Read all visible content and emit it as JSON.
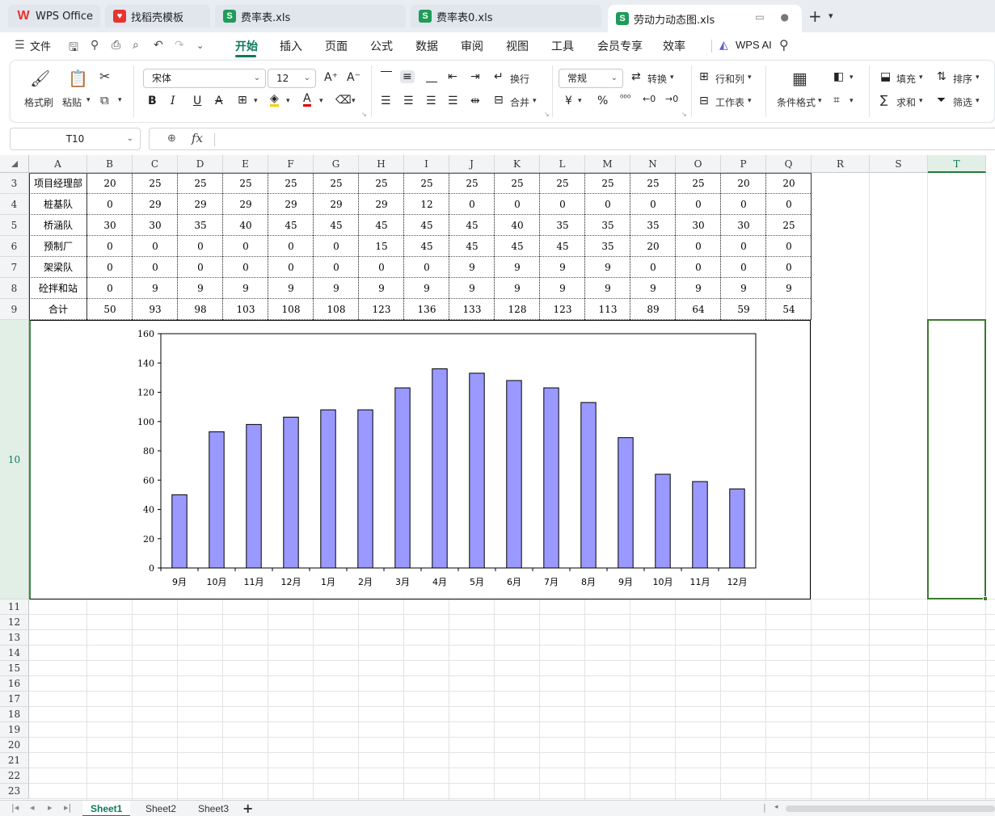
{
  "tabs": [
    {
      "label": "WPS Office",
      "icon": "wps-logo-icon"
    },
    {
      "label": "找稻壳模板",
      "icon": "daoke-icon"
    },
    {
      "label": "费率表.xls",
      "icon": "sheet-icon"
    },
    {
      "label": "费率表0.xls",
      "icon": "sheet-icon"
    },
    {
      "label": "劳动力动态图.xls",
      "icon": "sheet-icon"
    }
  ],
  "menu": {
    "file": "文件",
    "items": [
      "开始",
      "插入",
      "页面",
      "公式",
      "数据",
      "审阅",
      "视图",
      "工具",
      "会员专享",
      "效率"
    ],
    "active": "开始",
    "wps_ai": "WPS AI"
  },
  "ribbon": {
    "format_painter": "格式刷",
    "paste": "粘贴",
    "font_name": "宋体",
    "font_size": "12",
    "wrap": "换行",
    "merge": "合并",
    "number_format": "常规",
    "convert": "转换",
    "row_col": "行和列",
    "worksheet": "工作表",
    "cond_format": "条件格式",
    "fill": "填充",
    "sum": "求和",
    "sort": "排序",
    "filter": "筛选",
    "accent_color": "#0c7a5b"
  },
  "formula": {
    "cell_ref": "T10",
    "fx": "fx",
    "content": ""
  },
  "columns": [
    "A",
    "B",
    "C",
    "D",
    "E",
    "F",
    "G",
    "H",
    "I",
    "J",
    "K",
    "L",
    "M",
    "N",
    "O",
    "P",
    "Q",
    "R",
    "S",
    "T"
  ],
  "selected_column": "T",
  "selected_row": "10",
  "rows": [
    {
      "num": "3",
      "label": "项目经理部",
      "values": [
        "20",
        "25",
        "25",
        "25",
        "25",
        "25",
        "25",
        "25",
        "25",
        "25",
        "25",
        "25",
        "25",
        "25",
        "20",
        "20"
      ]
    },
    {
      "num": "4",
      "label": "桩基队",
      "values": [
        "0",
        "29",
        "29",
        "29",
        "29",
        "29",
        "29",
        "12",
        "0",
        "0",
        "0",
        "0",
        "0",
        "0",
        "0",
        "0"
      ]
    },
    {
      "num": "5",
      "label": "桥涵队",
      "values": [
        "30",
        "30",
        "35",
        "40",
        "45",
        "45",
        "45",
        "45",
        "45",
        "40",
        "35",
        "35",
        "35",
        "30",
        "30",
        "25"
      ]
    },
    {
      "num": "6",
      "label": "预制厂",
      "values": [
        "0",
        "0",
        "0",
        "0",
        "0",
        "0",
        "15",
        "45",
        "45",
        "45",
        "45",
        "35",
        "20",
        "0",
        "0",
        "0"
      ]
    },
    {
      "num": "7",
      "label": "架梁队",
      "values": [
        "0",
        "0",
        "0",
        "0",
        "0",
        "0",
        "0",
        "0",
        "9",
        "9",
        "9",
        "9",
        "0",
        "0",
        "0",
        "0"
      ]
    },
    {
      "num": "8",
      "label": "砼拌和站",
      "values": [
        "0",
        "9",
        "9",
        "9",
        "9",
        "9",
        "9",
        "9",
        "9",
        "9",
        "9",
        "9",
        "9",
        "9",
        "9",
        "9"
      ]
    },
    {
      "num": "9",
      "label": "合计",
      "values": [
        "50",
        "93",
        "98",
        "103",
        "108",
        "108",
        "123",
        "136",
        "133",
        "128",
        "123",
        "113",
        "89",
        "64",
        "59",
        "54"
      ]
    }
  ],
  "empty_rows": [
    "11",
    "12",
    "13",
    "14",
    "15",
    "16",
    "17",
    "18",
    "19",
    "20",
    "21",
    "22",
    "23"
  ],
  "chart_data": {
    "type": "bar",
    "categories": [
      "9月",
      "10月",
      "11月",
      "12月",
      "1月",
      "2月",
      "3月",
      "4月",
      "5月",
      "6月",
      "7月",
      "8月",
      "9月",
      "10月",
      "11月",
      "12月"
    ],
    "values": [
      50,
      93,
      98,
      103,
      108,
      108,
      123,
      136,
      133,
      128,
      123,
      113,
      89,
      64,
      59,
      54
    ],
    "title": "",
    "xlabel": "",
    "ylabel": "",
    "ylim": [
      0,
      160
    ],
    "yticks": [
      0,
      20,
      40,
      60,
      80,
      100,
      120,
      140,
      160
    ],
    "bar_color": "#9999ff",
    "grid": false,
    "legend": "none"
  },
  "sheets": [
    "Sheet1",
    "Sheet2",
    "Sheet3"
  ],
  "active_sheet": "Sheet1"
}
